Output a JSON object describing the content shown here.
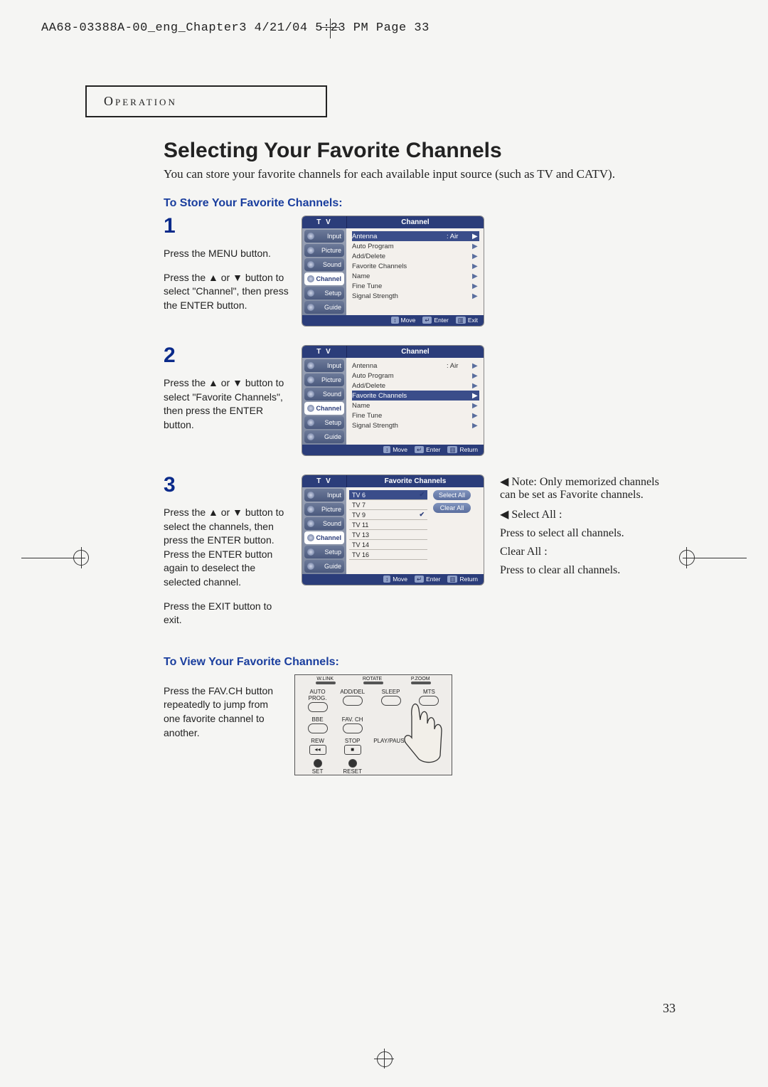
{
  "scan_header": "AA68-03388A-00_eng_Chapter3  4/21/04  5:23 PM  Page 33",
  "operation_label": "Operation",
  "title": "Selecting Your Favorite Channels",
  "intro": "You can store your favorite channels for each available input source (such as TV and CATV).",
  "section_store": "To Store Your Favorite Channels:",
  "section_view": "To View Your Favorite Channels:",
  "page_number": "33",
  "steps": {
    "s1_num": "1",
    "s1_a": "Press the MENU button.",
    "s1_b": "Press the ▲ or ▼ button to select \"Channel\", then press the ENTER button.",
    "s2_num": "2",
    "s2": "Press the ▲ or ▼ button to select \"Favorite Channels\", then press the ENTER button.",
    "s3_num": "3",
    "s3_a": "Press the ▲ or ▼ button to select the channels, then press the ENTER button. Press the ENTER button again to deselect the selected channel.",
    "s3_b": "Press the EXIT button to exit.",
    "view": "Press the FAV.CH button repeatedly to jump from one favorite channel to another."
  },
  "osd": {
    "tv": "T V",
    "channel_title": "Channel",
    "fav_title": "Favorite Channels",
    "sidebar": [
      "Input",
      "Picture",
      "Sound",
      "Channel",
      "Setup",
      "Guide"
    ],
    "menu": {
      "antenna": "Antenna",
      "antenna_val": ": Air",
      "auto_program": "Auto Program",
      "add_delete": "Add/Delete",
      "favorite": "Favorite Channels",
      "name": "Name",
      "fine_tune": "Fine Tune",
      "signal": "Signal Strength"
    },
    "footer": {
      "move": "Move",
      "enter": "Enter",
      "exit": "Exit",
      "return": "Return"
    },
    "fav_channels": [
      "TV 6",
      "TV 7",
      "TV 9",
      "TV 11",
      "TV 13",
      "TV 14",
      "TV 16"
    ],
    "select_all": "Select All",
    "clear_all": "Clear All"
  },
  "notes": {
    "n1": "Note: Only memorized channels can be set as Favorite channels.",
    "n2_t": "Select All :",
    "n2_b": "Press to select all channels.",
    "n3_t": "Clear All :",
    "n3_b": "Press to clear all channels."
  },
  "remote": {
    "top": [
      "W.LINK",
      "ROTATE",
      "P.ZOOM"
    ],
    "r1": [
      "AUTO PROG.",
      "ADD/DEL",
      "SLEEP",
      "MTS"
    ],
    "r2": [
      "BBE",
      "FAV. CH",
      "",
      ""
    ],
    "r3": [
      "REW",
      "STOP",
      "PLAY/PAUSE",
      ""
    ],
    "r4": [
      "SET",
      "RESET",
      "",
      ""
    ]
  }
}
